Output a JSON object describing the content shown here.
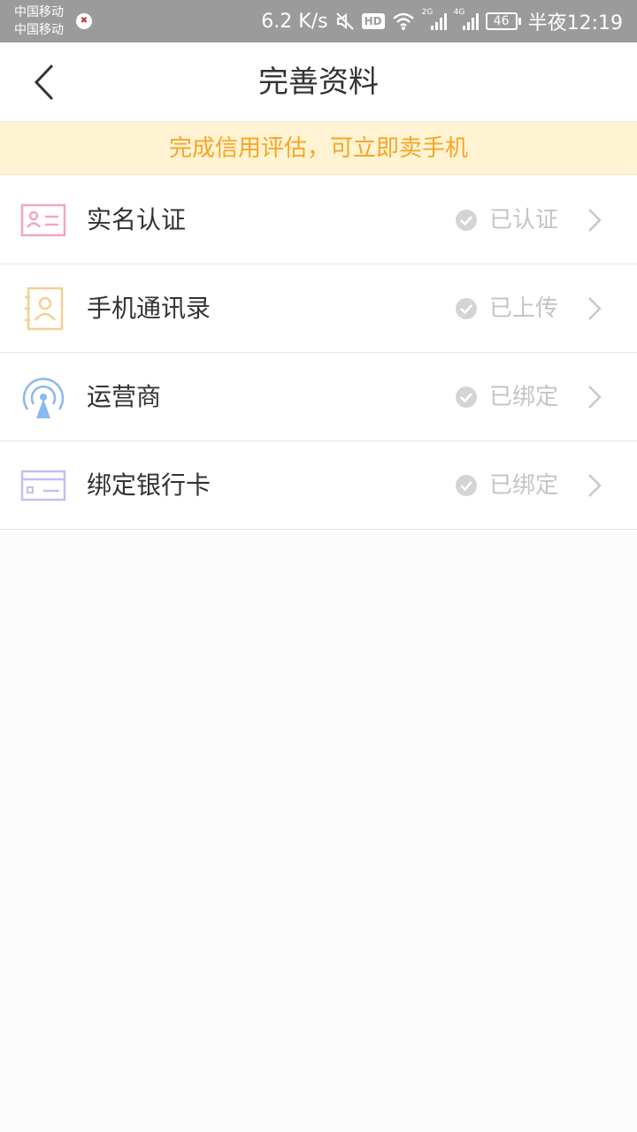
{
  "status_bar": {
    "carrier_1": "中国移动",
    "carrier_2": "中国移动",
    "net_speed": "6.2 K/s",
    "hd": "HD",
    "signal_1_type": "2G",
    "signal_2_type": "4G",
    "battery": "46",
    "time": "半夜12:19"
  },
  "header": {
    "title": "完善资料"
  },
  "notice": {
    "text": "完成信用评估，可立即卖手机"
  },
  "items": [
    {
      "label": "实名认证",
      "status": "已认证",
      "icon": "id-card-icon",
      "color": "#f3a6bd"
    },
    {
      "label": "手机通讯录",
      "status": "已上传",
      "icon": "contacts-book-icon",
      "color": "#f6cf8f"
    },
    {
      "label": "运营商",
      "status": "已绑定",
      "icon": "signal-tower-icon",
      "color": "#8ab8f0"
    },
    {
      "label": "绑定银行卡",
      "status": "已绑定",
      "icon": "bank-card-icon",
      "color": "#c8bdf0"
    }
  ],
  "colors": {
    "accent_text": "#f5a623",
    "notice_bg": "#fff3d3",
    "status_gray": "#c4c4c4"
  }
}
